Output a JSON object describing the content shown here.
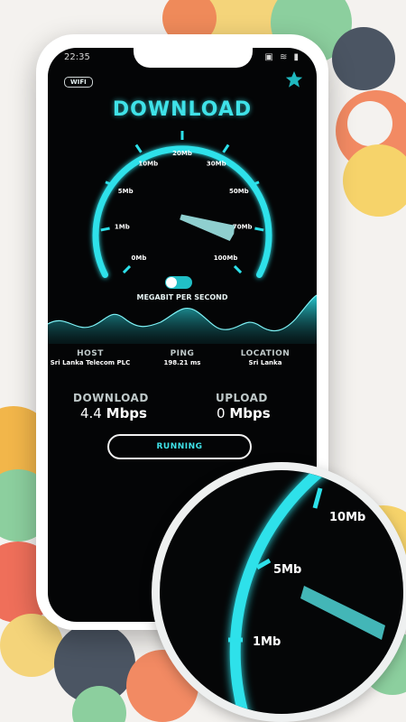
{
  "status": {
    "time": "22:35",
    "icons": "▣ ≋ ▮"
  },
  "header": {
    "network_badge": "WIFI",
    "icon": "star-icon"
  },
  "title": "DOWNLOAD",
  "gauge": {
    "tick_labels": [
      "0Mb",
      "1Mb",
      "5Mb",
      "10Mb",
      "20Mb",
      "30Mb",
      "50Mb",
      "70Mb",
      "100Mb"
    ],
    "current_speed": 4.4,
    "unit_label": "MEGABIT PER SECOND",
    "toggle_on": true
  },
  "info": {
    "host_label": "HOST",
    "host_value": "Sri Lanka Telecom PLC",
    "ping_label": "PING",
    "ping_value": "198.21 ms",
    "location_label": "LOCATION",
    "location_value": "Sri Lanka"
  },
  "stats": {
    "download_label": "DOWNLOAD",
    "download_value": "4.4",
    "download_unit": "Mbps",
    "upload_label": "UPLOAD",
    "upload_value": "0",
    "upload_unit": "Mbps"
  },
  "action_button": "RUNNING",
  "magnifier": {
    "labels": [
      "10Mb",
      "5Mb",
      "1Mb"
    ]
  },
  "colors": {
    "accent": "#3fe2e8",
    "background": "#040506"
  }
}
